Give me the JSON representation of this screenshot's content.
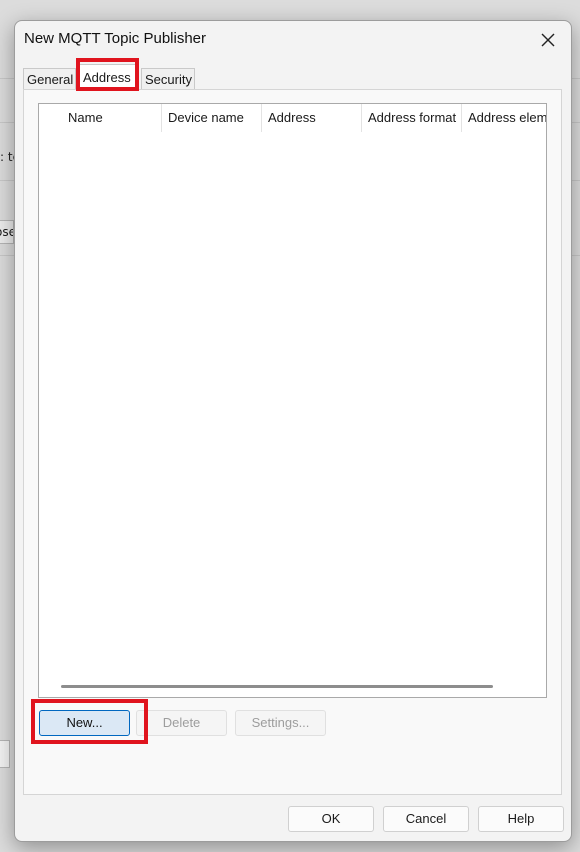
{
  "background": {
    "left_text_1": ": te",
    "left_text_2": "ose"
  },
  "dialog": {
    "title": "New MQTT Topic Publisher",
    "close_icon": "close-icon"
  },
  "tabs": [
    {
      "label": "General",
      "selected": false
    },
    {
      "label": "Address",
      "selected": true
    },
    {
      "label": "Security",
      "selected": false
    }
  ],
  "list": {
    "columns": [
      "Name",
      "Device name",
      "Address",
      "Address format",
      "Address elem"
    ],
    "rows": []
  },
  "actions": {
    "new_label": "New...",
    "delete_label": "Delete",
    "settings_label": "Settings..."
  },
  "footer": {
    "ok_label": "OK",
    "cancel_label": "Cancel",
    "help_label": "Help"
  },
  "colors": {
    "highlight": "#e0141e",
    "accent": "#0067c0"
  }
}
